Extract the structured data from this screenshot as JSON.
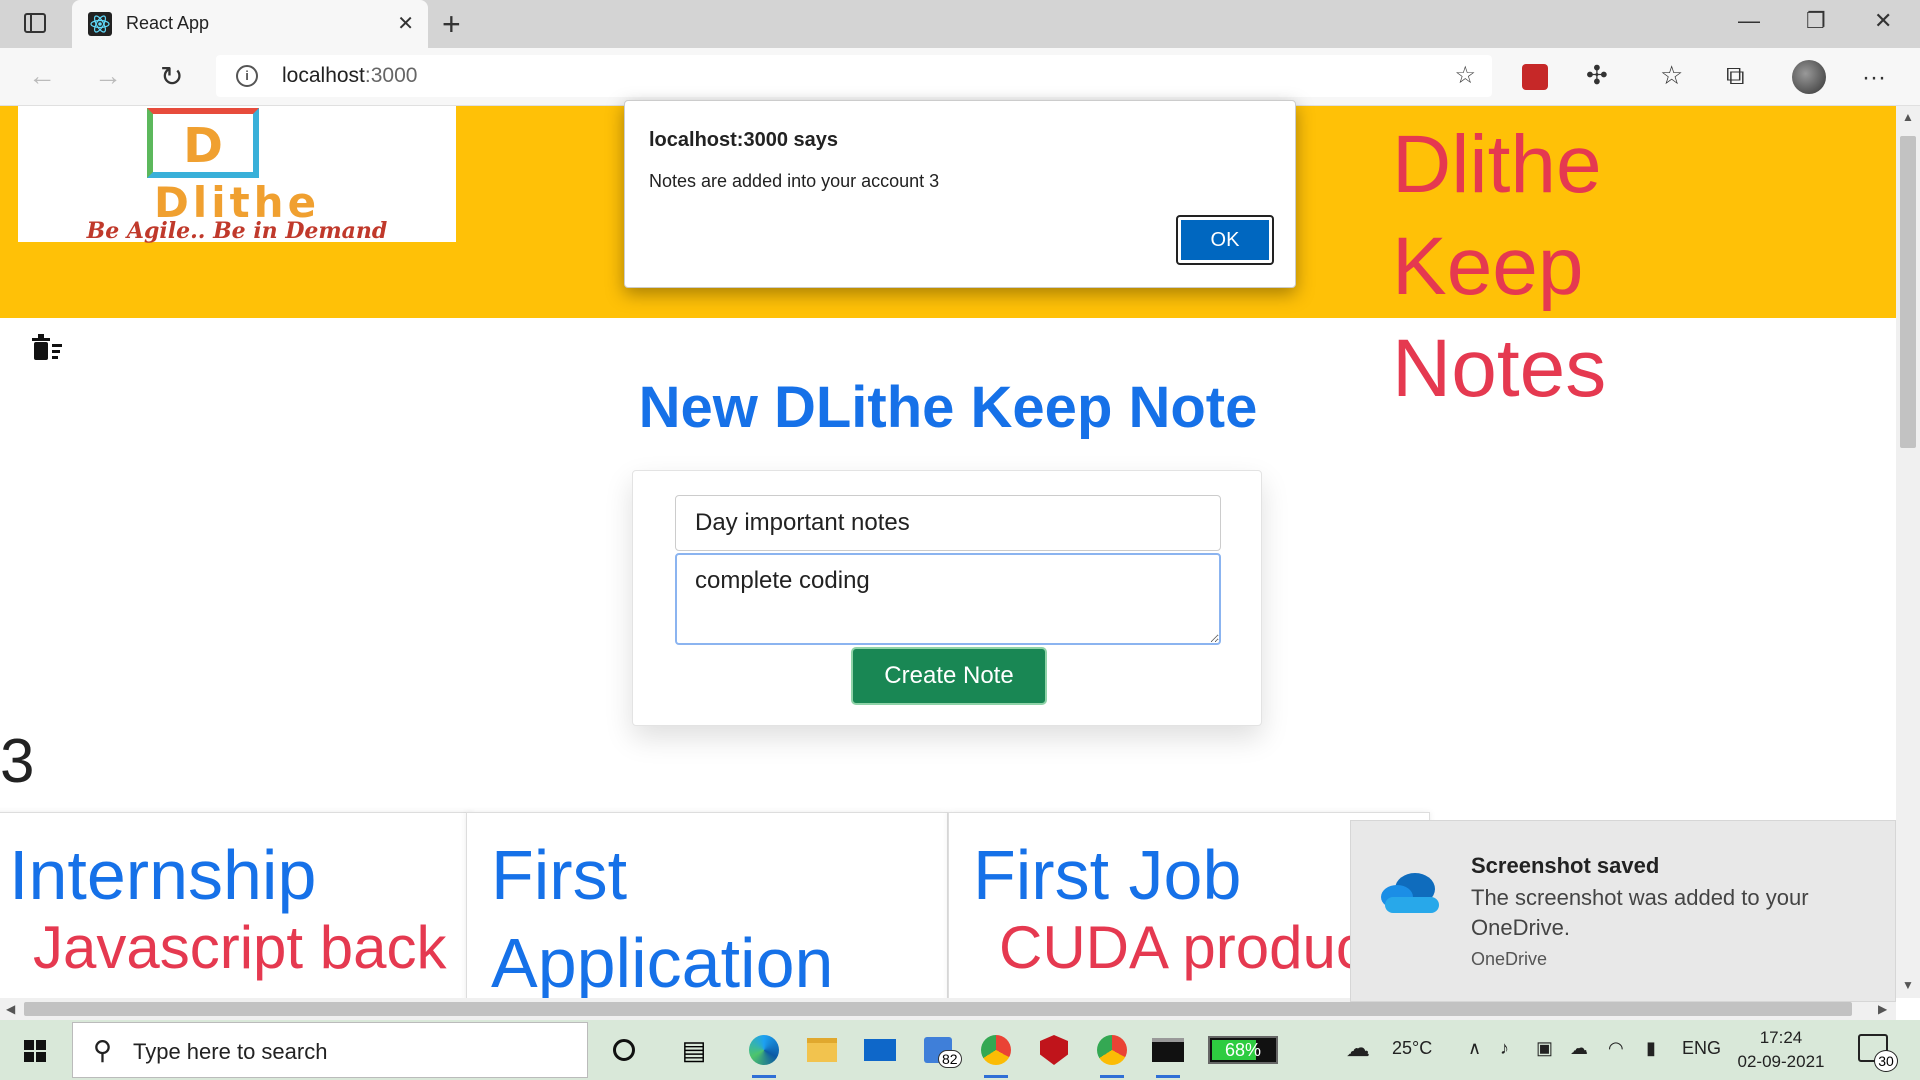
{
  "browser": {
    "tab_title": "React App",
    "tab_close": "✕",
    "new_tab": "+",
    "url_host": "localhost",
    "url_port": ":3000",
    "window_controls": [
      "—",
      "❐",
      "✕"
    ],
    "menu": "···"
  },
  "header": {
    "logo_letter": "D",
    "logo_word": "Dlithe",
    "logo_tagline": "Be Agile.. Be in Demand",
    "brand_title": "Dlithe Keep Notes",
    "accent_color": "#ffc107"
  },
  "main": {
    "heading": "New DLithe Keep Note",
    "title_value": "Day important notes",
    "body_value": "complete coding",
    "create_label": "Create Note",
    "count": "3"
  },
  "notes": [
    {
      "title": "Internship",
      "body": "Javascript back"
    },
    {
      "title": "First Application",
      "body": ""
    },
    {
      "title": "First Job",
      "body": "CUDA product"
    }
  ],
  "dialog": {
    "title": "localhost:3000 says",
    "message": "Notes are added into your account 3",
    "ok_label": "OK"
  },
  "toast": {
    "title": "Screenshot saved",
    "text": "The screenshot was added to your OneDrive.",
    "app": "OneDrive"
  },
  "taskbar": {
    "search_placeholder": "Type here to search",
    "store_badge": "82",
    "battery": "68%",
    "temperature": "25°C",
    "language": "ENG",
    "time": "17:24",
    "date": "02-09-2021",
    "notifications": "30"
  }
}
